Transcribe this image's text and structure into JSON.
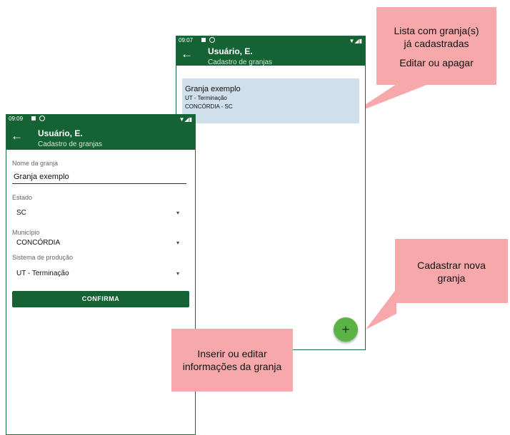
{
  "right_phone": {
    "status_time": "09:07",
    "signal": "▼◢▮",
    "header_name": "Usuário, E.",
    "header_subtitle": "Cadastro de granjas",
    "farm": {
      "name": "Granja exemplo",
      "system": "UT - Terminação",
      "location": "CONCÓRDIA - SC"
    },
    "fab_label": "+"
  },
  "left_phone": {
    "status_time": "09:09",
    "signal": "▼◢▮",
    "header_name": "Usuário, E.",
    "header_subtitle": "Cadastro de granjas",
    "farm_name_label": "Nome da granja",
    "farm_name_value": "Granja exemplo",
    "state_label": "Estado",
    "state_value": "SC",
    "city_label": "Município",
    "city_value": "CONCÓRDIA",
    "system_label": "Sistema de produção",
    "system_value": "UT - Terminação",
    "confirm_label": "CONFIRMA"
  },
  "callouts": {
    "list_line1": "Lista com granja(s)",
    "list_line2": "já cadastradas",
    "list_line3": "Editar ou apagar",
    "new_line1": "Cadastrar nova",
    "new_line2": "granja",
    "edit_line1": "Inserir ou editar",
    "edit_line2": "informações da granja"
  },
  "colors": {
    "primary": "#156334",
    "fab": "#5bb346",
    "card": "#cfe0ec",
    "callout": "#f7a8ab"
  },
  "icons": {
    "back": "←",
    "caret": "▾"
  }
}
